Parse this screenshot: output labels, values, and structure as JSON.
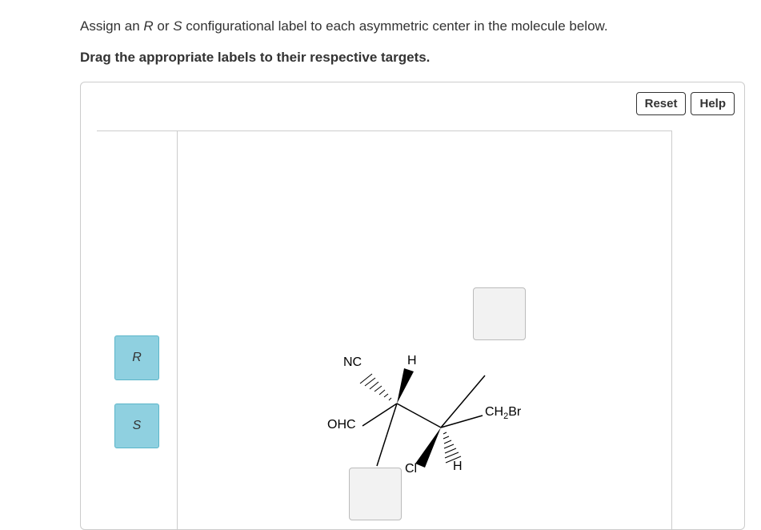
{
  "question": {
    "prefix": "Assign an ",
    "r": "R",
    "mid1": " or ",
    "s": "S",
    "suffix": " configurational label to each asymmetric center in the molecule below."
  },
  "instruction": "Drag the appropriate labels to their respective targets.",
  "toolbar": {
    "reset": "Reset",
    "help": "Help"
  },
  "palette": {
    "r_label": "R",
    "s_label": "S"
  },
  "molecule": {
    "labels": {
      "nc": "NC",
      "h_top": "H",
      "ohc": "OHC",
      "cl": "Cl",
      "h_bottom": "H",
      "ch2br_prefix": "CH",
      "ch2br_sub": "2",
      "ch2br_suffix": "Br"
    }
  }
}
